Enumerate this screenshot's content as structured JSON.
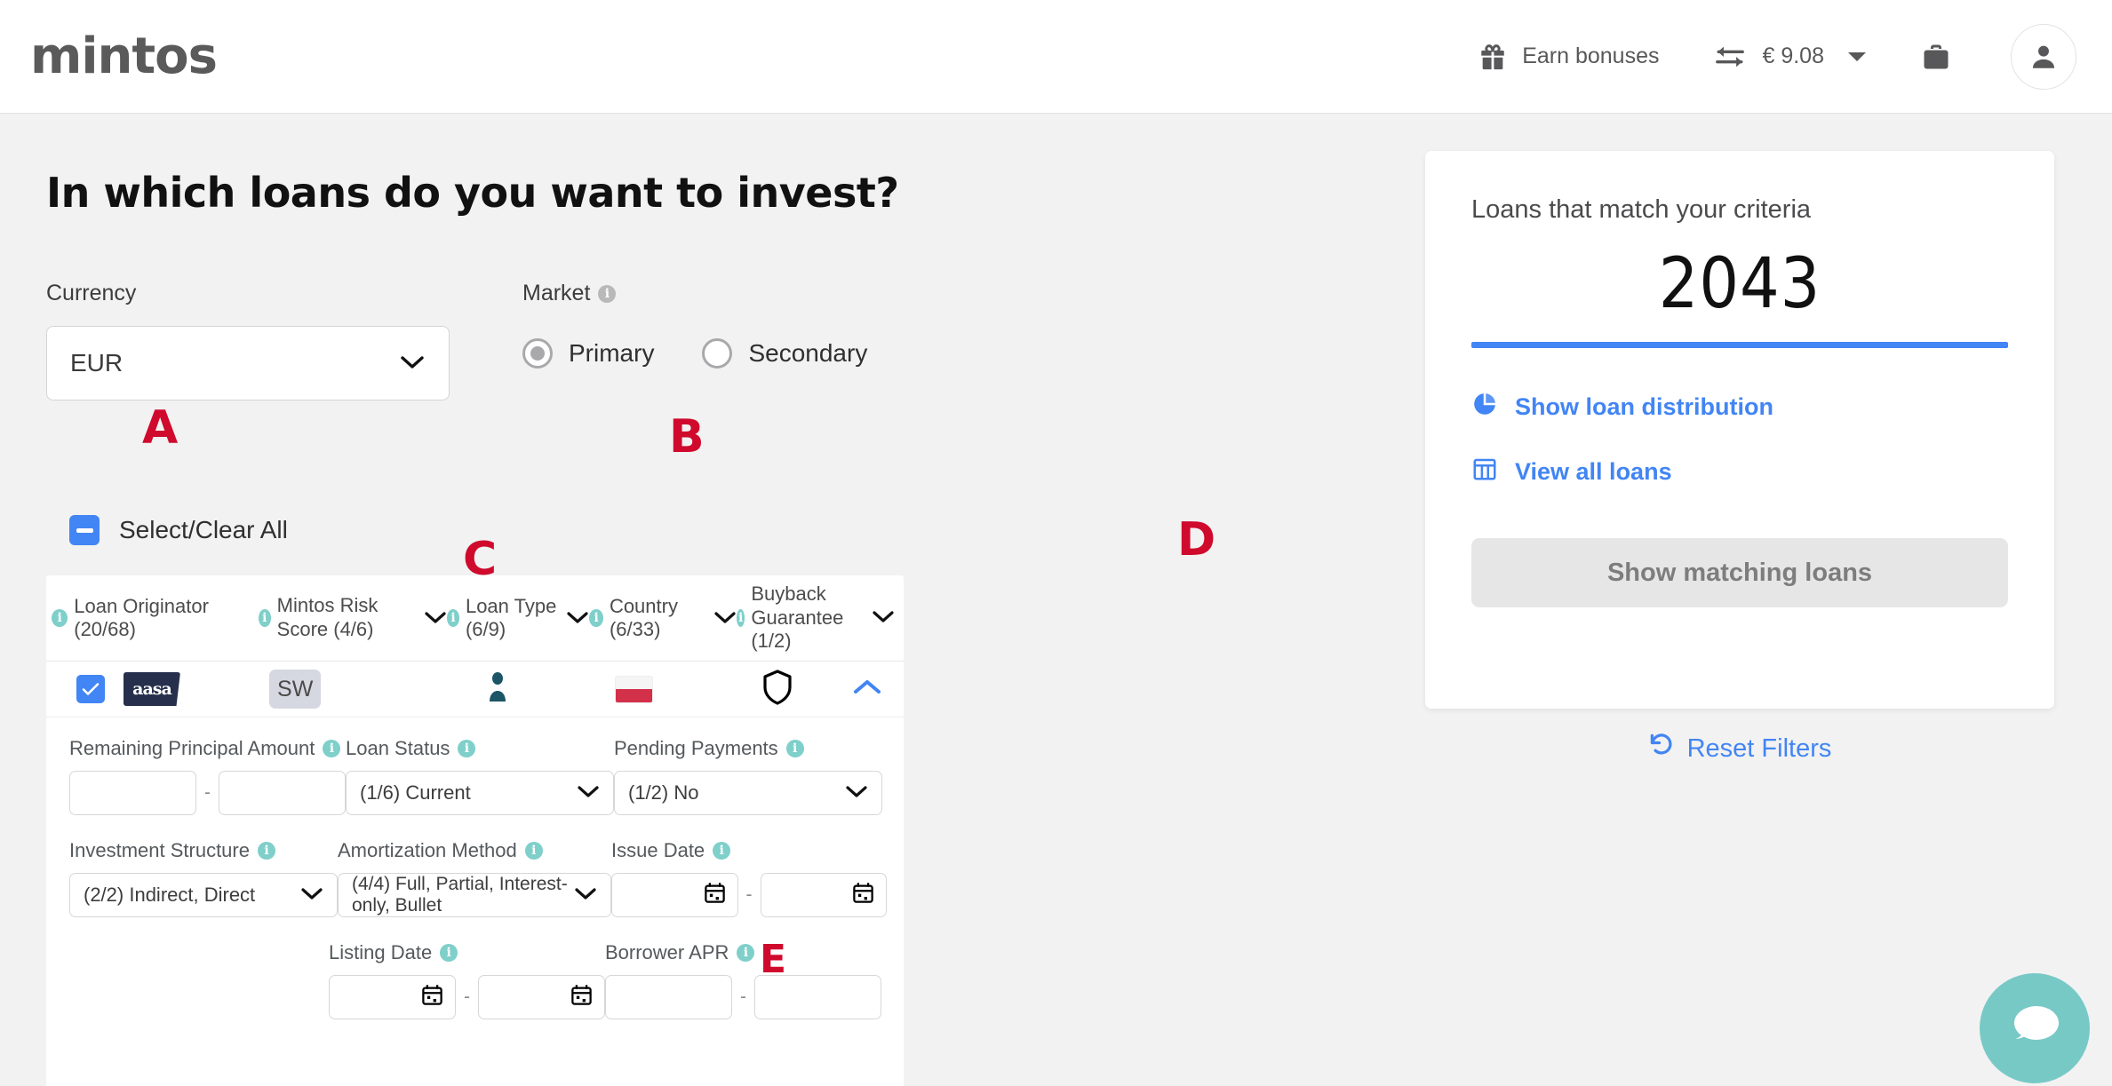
{
  "header": {
    "logo": "mintos",
    "earn_bonuses": "Earn bonuses",
    "balance": "€ 9.08",
    "icons": {
      "gift": "gift-icon",
      "transfer": "transfer-arrows-icon",
      "caret": "caret-down-icon",
      "briefcase": "briefcase-icon",
      "user": "user-avatar-icon"
    }
  },
  "main": {
    "page_title": "In which loans do you want to invest?",
    "currency": {
      "label": "Currency",
      "value": "EUR"
    },
    "market": {
      "label": "Market",
      "options": [
        {
          "label": "Primary",
          "selected": true
        },
        {
          "label": "Secondary",
          "selected": false
        }
      ]
    },
    "select_clear_all": "Select/Clear All",
    "filter_columns": [
      {
        "label": "Loan Originator (20/68)",
        "has_chevron": false
      },
      {
        "label": "Mintos Risk Score (4/6)",
        "has_chevron": true
      },
      {
        "label": "Loan Type (6/9)",
        "has_chevron": true
      },
      {
        "label": "Country (6/33)",
        "has_chevron": true
      },
      {
        "label": "Buyback Guarantee (1/2)",
        "has_chevron": true
      }
    ],
    "originator_row": {
      "originator_logo_text": "aasa",
      "score_badge": "SW",
      "loan_type_icon": "person-icon",
      "country_flag": "poland-flag-icon",
      "buyback_icon": "shield-icon",
      "collapse_icon": "chevron-up-icon"
    },
    "fields": {
      "remaining_principal": {
        "label": "Remaining Principal Amount",
        "from": "",
        "to": "",
        "separator": "-"
      },
      "loan_status": {
        "label": "Loan Status",
        "value": "(1/6) Current"
      },
      "pending_payments": {
        "label": "Pending Payments",
        "value": "(1/2) No"
      },
      "investment_structure": {
        "label": "Investment Structure",
        "value": "(2/2) Indirect, Direct"
      },
      "amortization_method": {
        "label": "Amortization Method",
        "value": "(4/4) Full, Partial, Interest-only, Bullet"
      },
      "issue_date": {
        "label": "Issue Date",
        "from": "",
        "to": "",
        "separator": "-"
      },
      "listing_date": {
        "label": "Listing Date",
        "from": "",
        "to": "",
        "separator": "-"
      },
      "borrower_apr": {
        "label": "Borrower APR",
        "from": "",
        "to": "",
        "separator": "-"
      }
    }
  },
  "right_panel": {
    "title": "Loans that match your criteria",
    "count": "2043",
    "show_loan_distribution": "Show loan distribution",
    "view_all_loans": "View all loans",
    "show_matching_loans": "Show matching loans",
    "reset_filters": "Reset Filters"
  },
  "chat": {
    "icon": "chat-bubble-icon"
  },
  "annotations": {
    "a": "A",
    "b": "B",
    "c": "C",
    "d": "D",
    "e": "E"
  },
  "colors": {
    "accent_blue": "#4285f4",
    "info_teal": "#7fcfca",
    "annotation_red": "#cf0a2c",
    "chat_teal": "#77c9c6"
  }
}
